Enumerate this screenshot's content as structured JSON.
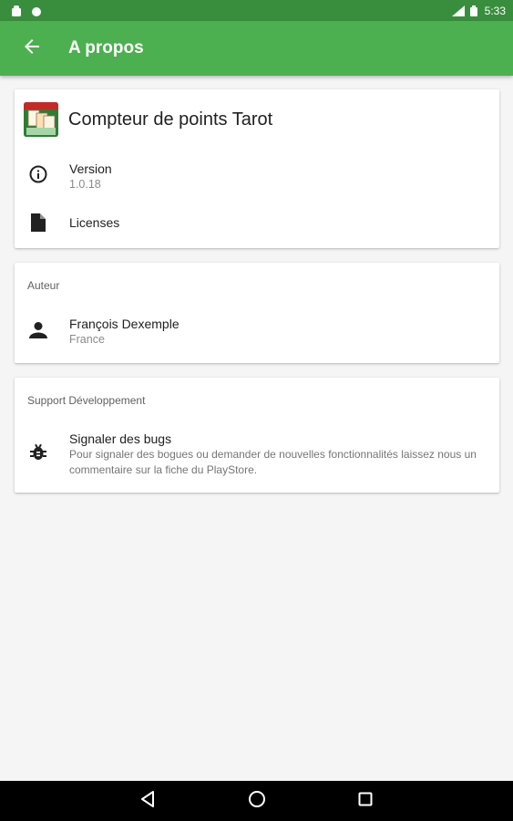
{
  "status_bar": {
    "time": "5:33",
    "icons": [
      "lock-icon",
      "android-icon",
      "signal-icon",
      "battery-icon"
    ]
  },
  "app_bar": {
    "title": "A propos",
    "back_icon": "arrow-back-icon",
    "color": "#4caf50"
  },
  "app_card": {
    "app_name": "Compteur de points Tarot",
    "items": [
      {
        "icon": "info-icon",
        "title": "Version",
        "subtitle": "1.0.18"
      },
      {
        "icon": "file-icon",
        "title": "Licenses"
      }
    ]
  },
  "author_card": {
    "header": "Auteur",
    "items": [
      {
        "icon": "person-icon",
        "title": "François Dexemple",
        "subtitle": "France"
      }
    ]
  },
  "support_card": {
    "header": "Support Développement",
    "items": [
      {
        "icon": "bug-icon",
        "title": "Signaler des bugs",
        "subtitle": "Pour signaler des bogues ou demander de nouvelles fonctionnalités laissez nous un commentaire sur la fiche du PlayStore."
      }
    ]
  },
  "nav_bar": {
    "buttons": [
      "back-triangle-icon",
      "home-circle-icon",
      "recents-square-icon"
    ]
  }
}
